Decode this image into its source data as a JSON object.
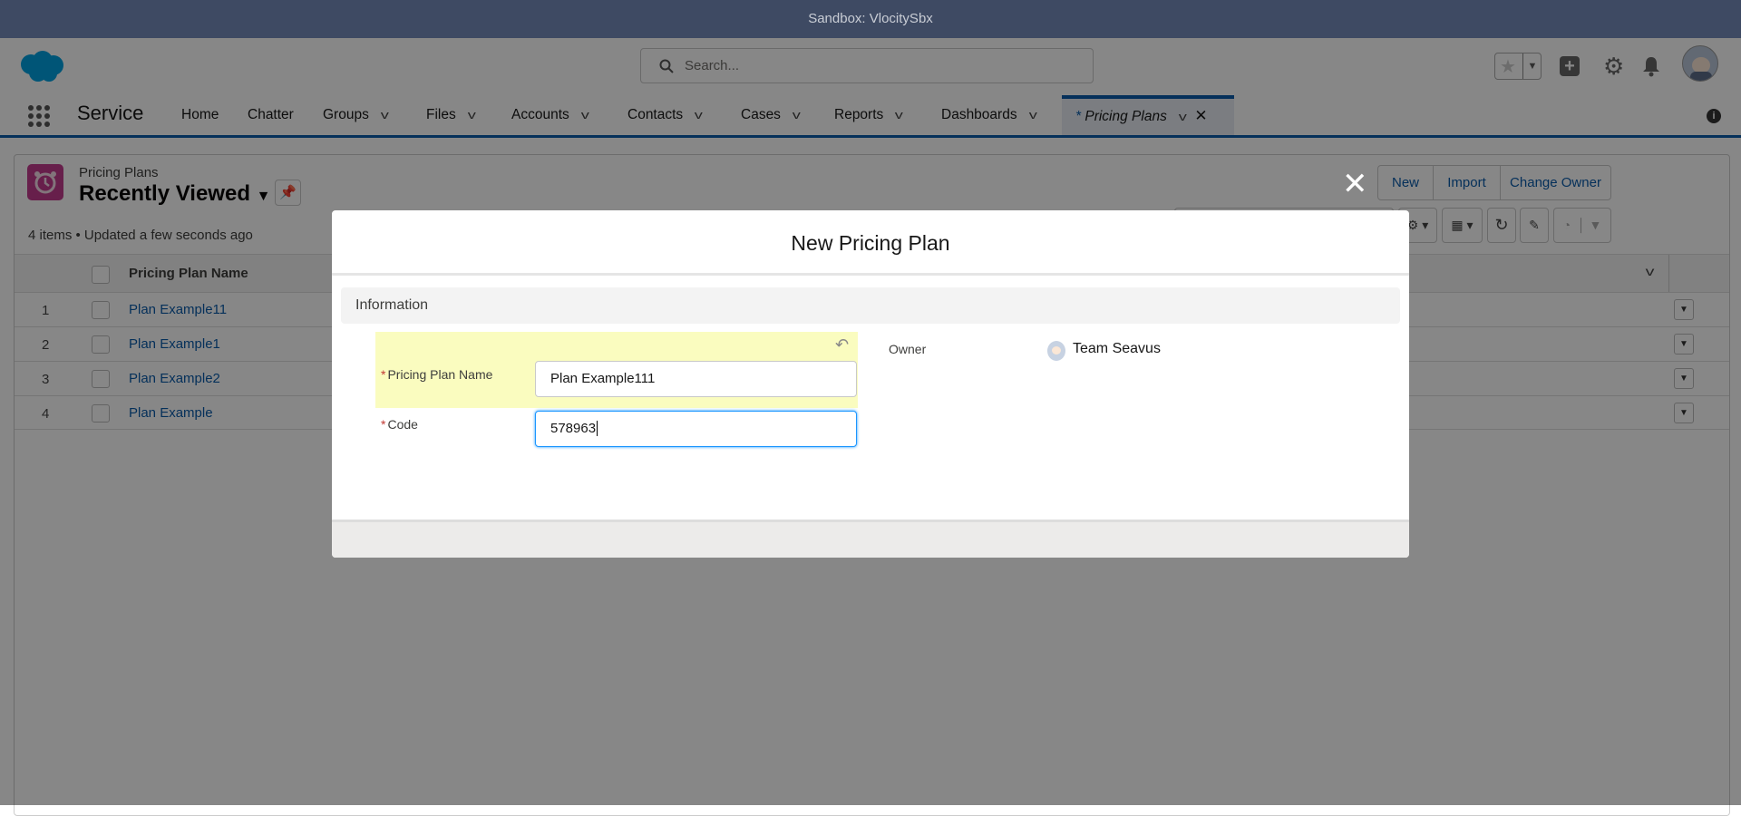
{
  "sandbox_banner": "Sandbox: VlocitySbx",
  "header": {
    "search_placeholder": "Search...",
    "app_name": "Service"
  },
  "nav": {
    "tabs": [
      {
        "label": "Home",
        "has_menu": false
      },
      {
        "label": "Chatter",
        "has_menu": false
      },
      {
        "label": "Groups",
        "has_menu": true
      },
      {
        "label": "Files",
        "has_menu": true
      },
      {
        "label": "Accounts",
        "has_menu": true
      },
      {
        "label": "Contacts",
        "has_menu": true
      },
      {
        "label": "Cases",
        "has_menu": true
      },
      {
        "label": "Reports",
        "has_menu": true
      },
      {
        "label": "Dashboards",
        "has_menu": true
      }
    ],
    "active_tab": {
      "prefix": "*",
      "label": "Pricing Plans"
    }
  },
  "list": {
    "object_label": "Pricing Plans",
    "view_name": "Recently Viewed",
    "status": "4 items • Updated a few seconds ago",
    "actions": [
      "New",
      "Import",
      "Change Owner"
    ],
    "column_header": "Pricing Plan Name",
    "rows": [
      {
        "num": "1",
        "name": "Plan Example11"
      },
      {
        "num": "2",
        "name": "Plan Example1"
      },
      {
        "num": "3",
        "name": "Plan Example2"
      },
      {
        "num": "4",
        "name": "Plan Example"
      }
    ]
  },
  "modal": {
    "title": "New Pricing Plan",
    "section": "Information",
    "fields": {
      "name_label": "Pricing Plan Name",
      "name_value": "Plan Example111",
      "code_label": "Code",
      "code_value": "578963",
      "owner_label": "Owner",
      "owner_value": "Team Seavus"
    }
  },
  "colors": {
    "brand": "#0b5cab",
    "object_icon": "#c23b8e",
    "highlight": "#fafcbf"
  }
}
